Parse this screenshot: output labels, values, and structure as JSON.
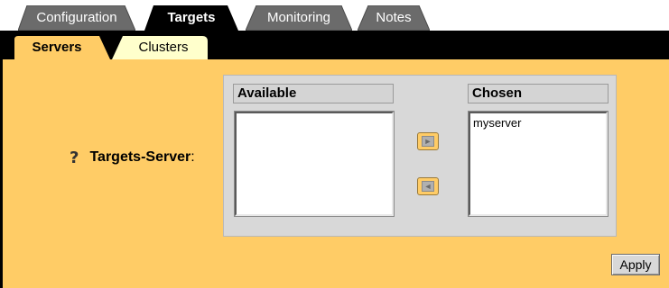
{
  "tabs": [
    {
      "label": "Configuration",
      "active": false
    },
    {
      "label": "Targets",
      "active": true
    },
    {
      "label": "Monitoring",
      "active": false
    },
    {
      "label": "Notes",
      "active": false
    }
  ],
  "subtabs": [
    {
      "label": "Servers",
      "active": true
    },
    {
      "label": "Clusters",
      "active": false
    }
  ],
  "form": {
    "help_icon": "?",
    "field_label": "Targets-Server",
    "field_colon": ":"
  },
  "picker": {
    "available_header": "Available",
    "chosen_header": "Chosen",
    "available_items": [],
    "chosen_items": [
      "myserver"
    ],
    "add_icon": "arrow-right-icon",
    "remove_icon": "arrow-left-icon"
  },
  "actions": {
    "apply_label": "Apply"
  },
  "colors": {
    "tab_inactive": "#6b6b6b",
    "tab_active": "#000000",
    "subtab_active": "#ffcc66",
    "subtab_inactive": "#ffffcc",
    "content_bg": "#ffcc66"
  }
}
